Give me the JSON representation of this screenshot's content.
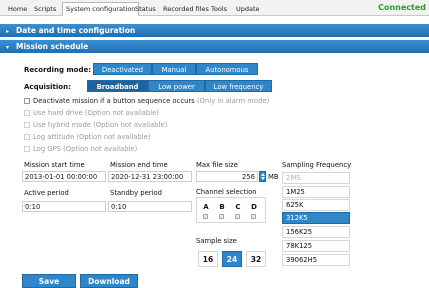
{
  "nav": {
    "tabs": [
      "Home",
      "Scripts",
      "System configuration",
      "Status",
      "Recorded files",
      "Tools",
      "Update"
    ],
    "status": "Connected"
  },
  "sections": {
    "date_time": "Date and time configuration",
    "mission": "Mission schedule"
  },
  "recording_mode": {
    "label": "Recording mode:",
    "options": [
      "Deactivated",
      "Manual",
      "Autonomous"
    ]
  },
  "acquisition": {
    "label": "Acquisition:",
    "options": [
      "Broadband",
      "Low power",
      "Low frequency"
    ],
    "selected": "Broadband"
  },
  "checkboxes": [
    {
      "label": "Deactivate mission if a button sequence occurs",
      "note": "(Only in alarm mode)",
      "enabled": true
    },
    {
      "label": "Use hard drive (Option not available)",
      "enabled": false
    },
    {
      "label": "Use hybrid mode (Option not available)",
      "enabled": false
    },
    {
      "label": "Log attitude (Option not available)",
      "enabled": false
    },
    {
      "label": "Log GPS (Option not available)",
      "enabled": false
    }
  ],
  "mission": {
    "start_label": "Mission start time",
    "start_value": "2013-01-01 00:00:00",
    "end_label": "Mission end time",
    "end_value": "2020-12-31 23:00:00",
    "active_label": "Active period",
    "active_value": "0:10",
    "standby_label": "Standby period",
    "standby_value": "0:10"
  },
  "file_size": {
    "label": "Max file size",
    "value": "256",
    "unit": "MB"
  },
  "channels": {
    "label": "Channel selection",
    "names": [
      "A",
      "B",
      "C",
      "D"
    ]
  },
  "sample_size": {
    "label": "Sample size",
    "options": [
      "16",
      "24",
      "32"
    ],
    "selected": "24"
  },
  "sampling": {
    "label": "Sampling Frequency",
    "options": [
      "2MS",
      "1M25",
      "625K",
      "312K5",
      "156K25",
      "78K125",
      "39062H5"
    ],
    "selected": "312K5",
    "disabled": "2MS"
  },
  "actions": {
    "save": "Save",
    "download": "Download"
  },
  "colors": {
    "accent": "#2f86c8",
    "accent_dark": "#1c63a0",
    "status_green": "#2d9a2d"
  }
}
